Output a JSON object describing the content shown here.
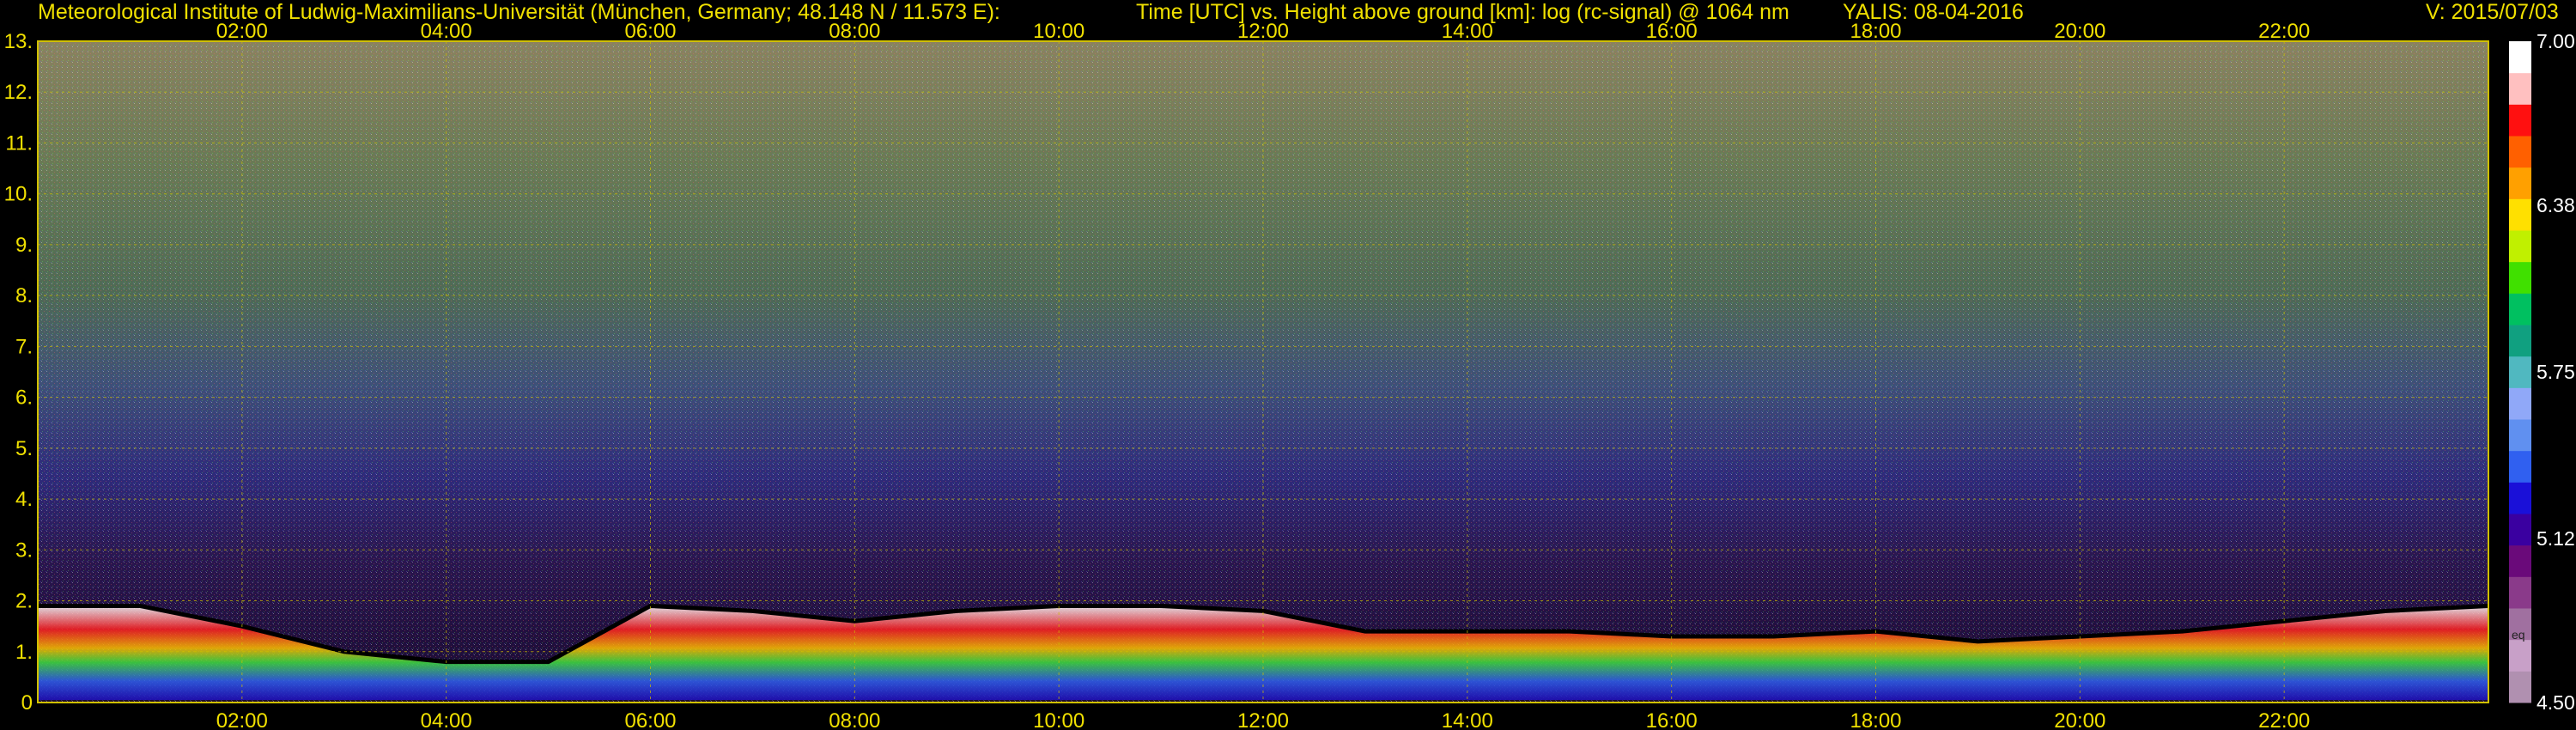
{
  "header": {
    "institute": "Meteorological Institute of Ludwig-Maximilians-Universität (München, Germany; 48.148 N / 11.573 E):",
    "plot_desc": "Time [UTC] vs. Height above ground [km]: log (rc-signal) @ 1064 nm",
    "instrument": "YALIS: 08-04-2016",
    "version": "V: 2015/07/03"
  },
  "chart_data": {
    "type": "heatmap",
    "title": "Time [UTC] vs. Height above ground [km]: log (rc-signal) @ 1064 nm",
    "x_ticks": [
      "02:00",
      "04:00",
      "06:00",
      "08:00",
      "10:00",
      "12:00",
      "14:00",
      "16:00",
      "18:00",
      "20:00",
      "22:00"
    ],
    "x_range_hours": [
      0,
      24
    ],
    "y_ticks": [
      "0",
      "1.",
      "2.",
      "3.",
      "4.",
      "5.",
      "6.",
      "7.",
      "8.",
      "9.",
      "10.",
      "11.",
      "12.",
      "13."
    ],
    "y_range_km": [
      0,
      13
    ],
    "colorbar": {
      "range": [
        4.5,
        7.0
      ],
      "tick_labels": [
        "7.00",
        "6.38",
        "5.75",
        "5.12",
        "4.50"
      ],
      "tick_values": [
        7.0,
        6.38,
        5.75,
        5.12,
        4.5
      ],
      "sublabel": "eq",
      "colors": [
        "#b090b0",
        "#c8a0c8",
        "#a070a0",
        "#8a3a8a",
        "#6a0a7a",
        "#3a00a0",
        "#1a10d8",
        "#3060f0",
        "#6090f0",
        "#90a8f8",
        "#50b8c0",
        "#10a080",
        "#00c060",
        "#40e000",
        "#c0f000",
        "#ffe000",
        "#ffa000",
        "#ff6000",
        "#ff1010",
        "#ffc0c0",
        "#ffffff"
      ]
    },
    "grid": true,
    "layers": [
      {
        "name": "boundary layer top",
        "approx_height_km": [
          1.3,
          2.1
        ]
      }
    ]
  }
}
